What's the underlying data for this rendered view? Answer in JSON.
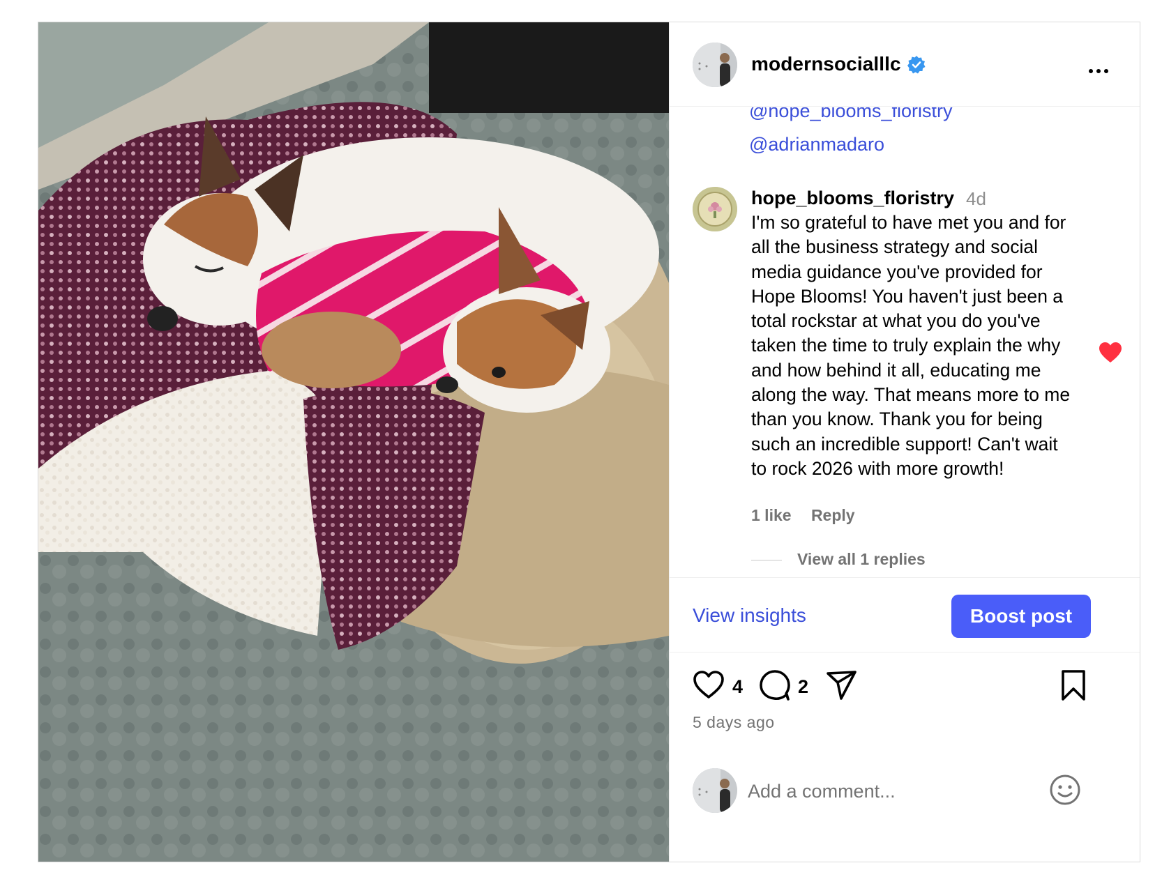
{
  "post": {
    "username": "modernsocialllc",
    "verified_icon": "verified-badge-icon",
    "more_icon": "more-options-icon",
    "photo_description_icon": "post-photo"
  },
  "comments": {
    "mention_clipped": "@hope_blooms_floristry",
    "mention_full": "@adrianmadaro",
    "items": [
      {
        "username": "hope_blooms_floristry",
        "time": "4d",
        "text": "I'm so grateful to have met you and for all the business strategy and social media guidance you've provided for Hope Blooms! You haven't just been a total rockstar at what you do you've taken the time to truly explain the why and how behind it all, educating me along the way. That means more to me than you know. Thank you for being such an incredible support! Can't wait to rock 2026 with more growth!",
        "likes": "1 like",
        "reply_label": "Reply",
        "view_replies": "View all 1 replies",
        "liked": true
      }
    ]
  },
  "insights": {
    "view_insights": "View insights",
    "boost_label": "Boost post"
  },
  "actions": {
    "like_count": "4",
    "comment_count": "2",
    "time_ago": "5 days ago"
  },
  "add_comment": {
    "placeholder": "Add a comment..."
  },
  "colors": {
    "link_blue": "#3a4ed9",
    "boost_blue": "#4a5df9",
    "verified_blue": "#3897f0",
    "liked_red": "#ff3040",
    "muted_gray": "#737373"
  }
}
